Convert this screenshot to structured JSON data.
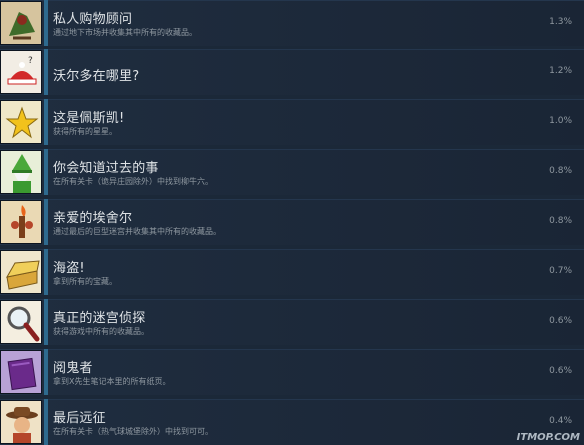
{
  "achievements": [
    {
      "title": "私人购物顾问",
      "desc": "通过地下市场并收集其中所有的收藏品。",
      "percent": "1.3%",
      "icon": "shopping-creature-icon",
      "fill": 0.013
    },
    {
      "title": "沃尔多在哪里?",
      "desc": "",
      "percent": "1.2%",
      "icon": "waldo-hat-icon",
      "fill": 0.012
    },
    {
      "title": "这是佩斯凯!",
      "desc": "获得所有的星星。",
      "percent": "1.0%",
      "icon": "star-icon",
      "fill": 0.01
    },
    {
      "title": "你会知道过去的事",
      "desc": "在所有关卡（诡异庄园除外）中找到柳牛六。",
      "percent": "0.8%",
      "icon": "wizard-icon",
      "fill": 0.008
    },
    {
      "title": "亲爱的埃舍尔",
      "desc": "通过最后的巨型迷宫并收集其中所有的收藏品。",
      "percent": "0.8%",
      "icon": "torch-creature-icon",
      "fill": 0.008
    },
    {
      "title": "海盗!",
      "desc": "拿到所有的宝藏。",
      "percent": "0.7%",
      "icon": "treasure-chest-icon",
      "fill": 0.007
    },
    {
      "title": "真正的迷宫侦探",
      "desc": "获得游戏中所有的收藏品。",
      "percent": "0.6%",
      "icon": "magnifier-icon",
      "fill": 0.006
    },
    {
      "title": "阅鬼者",
      "desc": "拿到X先生笔记本里的所有纸页。",
      "percent": "0.6%",
      "icon": "notebook-icon",
      "fill": 0.006
    },
    {
      "title": "最后远征",
      "desc": "在所有关卡（热气球城堡除外）中找到可可。",
      "percent": "0.4%",
      "icon": "explorer-icon",
      "fill": 0.004
    }
  ],
  "watermark": "ITMOP.COM",
  "colors": {
    "background": "#1b2838",
    "bar": "#2e6a8e",
    "title": "#dfe3e6",
    "muted": "#8f98a0"
  }
}
